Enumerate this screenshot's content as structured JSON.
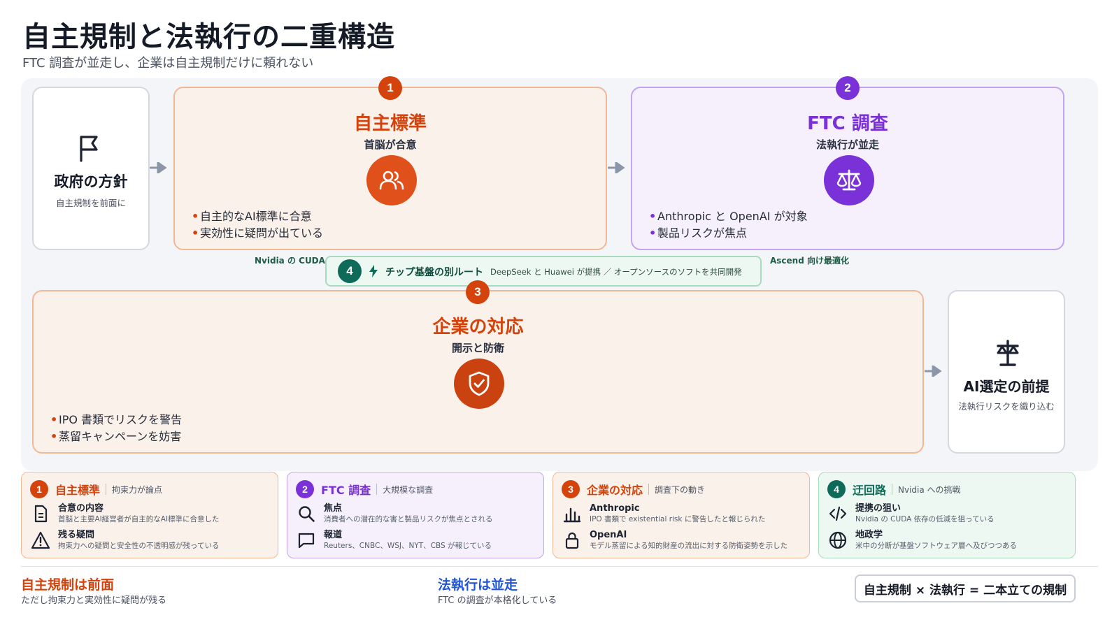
{
  "header": {
    "title": "自主規制と法執行の二重構造",
    "subtitle": "FTC 調査が並走し、企業は自主規制だけに頼れない"
  },
  "flow": {
    "policy": {
      "title": "政府の方針",
      "sub": "自主規制を前面に",
      "icon": "flag-icon"
    },
    "standards": {
      "num": "1",
      "title": "自主標準",
      "sub": "首脳が合意",
      "icon": "users-icon",
      "bullets": [
        "自主的なAI標準に合意",
        "実効性に疑問が出ている"
      ]
    },
    "ftc": {
      "num": "2",
      "title": "FTC 調査",
      "sub": "法執行が並走",
      "icon": "scales-icon",
      "bullets": [
        "Anthropic と OpenAI が対象",
        "製品リスクが焦点"
      ]
    },
    "response": {
      "num": "3",
      "title": "企業の対応",
      "sub": "開示と防衛",
      "icon": "shield-check-icon",
      "bullets": [
        "IPO 書類でリスクを警告",
        "蒸留キャンペーンを妨害"
      ]
    },
    "premise": {
      "title": "AI選定の前提",
      "sub": "法執行リスクを織り込む",
      "icon": "balance-icon"
    },
    "route": {
      "num": "4",
      "title": "チップ基盤の別ルート",
      "desc": "DeepSeek と Huawei が提携 ／ オープンソースのソフトを共同開発",
      "left_label": "Nvidia の CUDA",
      "right_label": "Ascend 向け最適化",
      "icon": "bolt-icon"
    }
  },
  "info_cards": [
    {
      "num": "1",
      "title": "自主標準",
      "tag": "拘束力が論点",
      "rows": [
        {
          "icon": "document-icon",
          "title": "合意の内容",
          "desc": "首脳と主要AI経営者が自主的なAI標準に合意した"
        },
        {
          "icon": "warning-icon",
          "title": "残る疑問",
          "desc": "拘束力への疑問と安全性の不透明感が残っている"
        }
      ]
    },
    {
      "num": "2",
      "title": "FTC 調査",
      "tag": "大規模な調査",
      "rows": [
        {
          "icon": "search-icon",
          "title": "焦点",
          "desc": "消費者への潜在的な害と製品リスクが焦点とされる"
        },
        {
          "icon": "chat-icon",
          "title": "報道",
          "desc": "Reuters、CNBC、WSJ、NYT、CBS が報じている"
        }
      ]
    },
    {
      "num": "3",
      "title": "企業の対応",
      "tag": "調査下の動き",
      "rows": [
        {
          "icon": "bar-chart-icon",
          "title": "Anthropic",
          "desc": "IPO 書類で existential risk に警告したと報じられた"
        },
        {
          "icon": "lock-icon",
          "title": "OpenAI",
          "desc": "モデル蒸留による知的財産の流出に対する防衛姿勢を示した"
        }
      ]
    },
    {
      "num": "4",
      "title": "迂回路",
      "tag": "Nvidia への挑戦",
      "rows": [
        {
          "icon": "code-icon",
          "title": "提携の狙い",
          "desc": "Nvidia の CUDA 依存の低減を狙っている"
        },
        {
          "icon": "globe-icon",
          "title": "地政学",
          "desc": "米中の分断が基盤ソフトウェア層へ及びつつある"
        }
      ]
    }
  ],
  "footer": {
    "left": {
      "title": "自主規制は前面",
      "sub": "ただし拘束力と実効性に疑問が残る"
    },
    "middle": {
      "title": "法執行は並走",
      "sub": "FTC の調査が本格化している"
    },
    "pill": "自主規制 × 法執行 = 二本立ての規制"
  },
  "colors": {
    "orange": "#d3430b",
    "purple": "#7a31d8",
    "green": "#0e6a59",
    "blue": "#1f55d6"
  }
}
